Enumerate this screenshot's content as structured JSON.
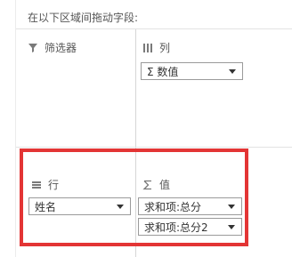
{
  "instruction": "在以下区域间拖动字段:",
  "areas": {
    "filter": {
      "label": "筛选器",
      "icon": "filter-icon"
    },
    "column": {
      "label": "列",
      "icon": "columns-icon",
      "fields": [
        {
          "label": "Σ 数值"
        }
      ]
    },
    "row": {
      "label": "行",
      "icon": "rows-icon",
      "fields": [
        {
          "label": "姓名"
        }
      ]
    },
    "value": {
      "label": "值",
      "icon": "sigma-icon",
      "fields": [
        {
          "label": "求和项:总分"
        },
        {
          "label": "求和项:总分2"
        }
      ]
    }
  },
  "colors": {
    "highlight": "#e33535",
    "chip_border": "#9a9a9a",
    "divider": "#d6d6d6"
  }
}
